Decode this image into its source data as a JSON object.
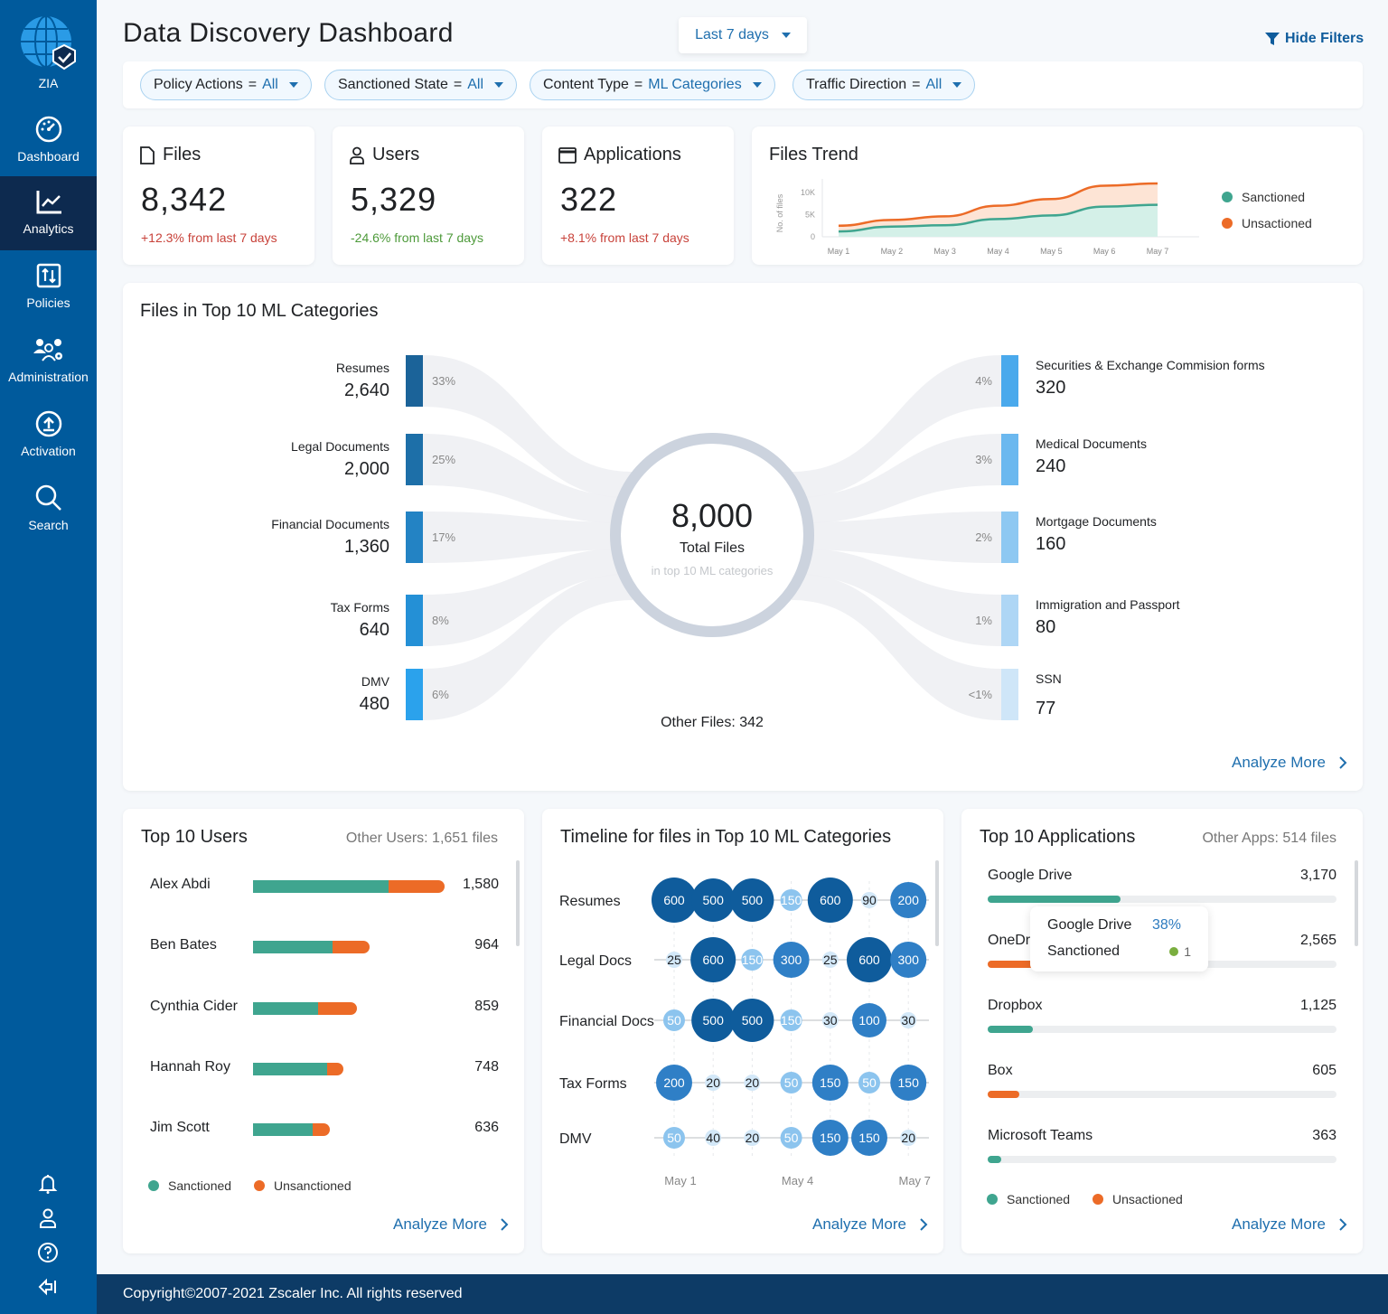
{
  "app": {
    "name": "ZIA"
  },
  "sidebar": {
    "items": [
      {
        "label": "Dashboard",
        "icon": "gauge-icon"
      },
      {
        "label": "Analytics",
        "icon": "chart-line-icon",
        "active": true
      },
      {
        "label": "Policies",
        "icon": "policies-icon"
      },
      {
        "label": "Administration",
        "icon": "users-gear-icon"
      },
      {
        "label": "Activation",
        "icon": "upload-icon"
      },
      {
        "label": "Search",
        "icon": "search-icon"
      }
    ],
    "bottom_icons": [
      "bell-icon",
      "user-icon",
      "help-icon",
      "collapse-icon"
    ]
  },
  "header": {
    "title": "Data Discovery Dashboard",
    "date_range": "Last 7 days",
    "hide_filters": "Hide Filters"
  },
  "filters": [
    {
      "key": "Policy Actions",
      "op": "=",
      "value": "All"
    },
    {
      "key": "Sanctioned State",
      "op": "=",
      "value": "All"
    },
    {
      "key": "Content Type",
      "op": "=",
      "value": "ML Categories"
    },
    {
      "key": "Traffic Direction",
      "op": "=",
      "value": "All"
    }
  ],
  "stats": [
    {
      "label": "Files",
      "icon": "file-icon",
      "value": "8,342",
      "change": "+12.3% from last 7 days",
      "trend": "negative"
    },
    {
      "label": "Users",
      "icon": "user-icon",
      "value": "5,329",
      "change": "-24.6% from last 7 days",
      "trend": "positive"
    },
    {
      "label": "Applications",
      "icon": "window-icon",
      "value": "322",
      "change": "+8.1% from last 7 days",
      "trend": "negative"
    }
  ],
  "colors": {
    "sanctioned": "#3fa58f",
    "unsanctioned": "#ec6b27",
    "accent": "#1f6fae",
    "sidebar": "#005a9c",
    "sidebar_active": "#0d2a4f"
  },
  "chart_data": [
    {
      "id": "files-trend",
      "type": "area",
      "title": "Files Trend",
      "ylabel": "No. of files",
      "yticks": [
        "0",
        "5K",
        "10K"
      ],
      "ylim": [
        0,
        12000
      ],
      "x": [
        "May 1",
        "May 2",
        "May 3",
        "May 4",
        "May 5",
        "May 6",
        "May 7"
      ],
      "series": [
        {
          "name": "Sanctioned",
          "values": [
            1200,
            2300,
            2600,
            4000,
            4800,
            6800,
            7200
          ]
        },
        {
          "name": "Unsactioned",
          "values": [
            2500,
            3800,
            4600,
            7000,
            8500,
            11500,
            12000
          ]
        }
      ],
      "legend": [
        "Sanctioned",
        "Unsactioned"
      ]
    },
    {
      "id": "ml-categories",
      "type": "sankey",
      "title": "Files in Top 10 ML Categories",
      "total": "8,000",
      "total_label": "Total Files",
      "total_sub": "in top 10 ML categories",
      "other": "Other Files: 342",
      "left": [
        {
          "name": "Resumes",
          "value": "2,640",
          "pct": "33%",
          "color": "#1b6399"
        },
        {
          "name": "Legal Documents",
          "value": "2,000",
          "pct": "25%",
          "color": "#1d6fa8"
        },
        {
          "name": "Financial Documents",
          "value": "1,360",
          "pct": "17%",
          "color": "#2383c4"
        },
        {
          "name": "Tax Forms",
          "value": "640",
          "pct": "8%",
          "color": "#2490d6"
        },
        {
          "name": "DMV",
          "value": "480",
          "pct": "6%",
          "color": "#2ba2ec"
        }
      ],
      "right": [
        {
          "name": "Securities & Exchange Commision forms",
          "value": "320",
          "pct": "4%",
          "color": "#4aa9ec"
        },
        {
          "name": "Medical Documents",
          "value": "240",
          "pct": "3%",
          "color": "#6bb8ef"
        },
        {
          "name": "Mortgage Documents",
          "value": "160",
          "pct": "2%",
          "color": "#8ec8f2"
        },
        {
          "name": "Immigration and Passport",
          "value": "80",
          "pct": "1%",
          "color": "#aed6f5"
        },
        {
          "name": "SSN",
          "value": "77",
          "pct": "<1%",
          "color": "#cfe6f8"
        }
      ]
    },
    {
      "id": "top-users",
      "type": "bar",
      "title": "Top 10 Users",
      "note": "Other Users: 1,651 files",
      "categories": [
        "Alex Abdi",
        "Ben Bates",
        "Cynthia Cider",
        "Hannah Roy",
        "Jim Scott"
      ],
      "totals": [
        "1,580",
        "964",
        "859",
        "748",
        "636"
      ],
      "series": [
        {
          "name": "Sanctioned",
          "values": [
            1120,
            656,
            534,
            608,
            491
          ]
        },
        {
          "name": "Unsanctioned",
          "values": [
            460,
            308,
            325,
            140,
            145
          ]
        }
      ],
      "xlim": [
        0,
        1580
      ],
      "legend": [
        "Sanctioned",
        "Unsanctioned"
      ]
    },
    {
      "id": "timeline",
      "type": "bubble",
      "title": "Timeline for files in Top 10 ML Categories",
      "x": [
        "May 1",
        "May 2",
        "May 3",
        "May 4",
        "May 5",
        "May 6",
        "May 7"
      ],
      "xtick_labels": [
        "May 1",
        "May 4",
        "May 7"
      ],
      "rows": [
        {
          "name": "Resumes",
          "values": [
            600,
            500,
            500,
            150,
            600,
            90,
            200
          ]
        },
        {
          "name": "Legal Docs",
          "values": [
            25,
            600,
            150,
            300,
            25,
            600,
            300
          ]
        },
        {
          "name": "Financial Docs",
          "values": [
            50,
            500,
            500,
            150,
            30,
            100,
            30
          ]
        },
        {
          "name": "Tax Forms",
          "values": [
            200,
            20,
            20,
            50,
            150,
            50,
            150
          ]
        },
        {
          "name": "DMV",
          "values": [
            50,
            40,
            20,
            50,
            150,
            150,
            20
          ]
        }
      ]
    },
    {
      "id": "top-apps",
      "type": "bar",
      "title": "Top 10 Applications",
      "note": "Other Apps: 514 files",
      "categories": [
        "Google Drive",
        "OneDrive",
        "Dropbox",
        "Box",
        "Microsoft Teams"
      ],
      "totals": [
        "3,170",
        "2,565",
        "1,125",
        "605",
        "363"
      ],
      "values": [
        3170,
        2565,
        1125,
        605,
        363
      ],
      "status": [
        "Sanctioned",
        "Unsanctioned",
        "Sanctioned",
        "Unsanctioned",
        "Sanctioned"
      ],
      "fill_fraction": [
        0.38,
        0.31,
        0.13,
        0.09,
        0.04
      ],
      "legend": [
        "Sanctioned",
        "Unsactioned"
      ],
      "tooltip": {
        "name": "Google Drive",
        "pct": "38%",
        "label": "Sanctioned",
        "count": "1"
      }
    }
  ],
  "analyze_more": "Analyze More",
  "footer": "Copyright©2007-2021 Zscaler Inc. All rights reserved"
}
